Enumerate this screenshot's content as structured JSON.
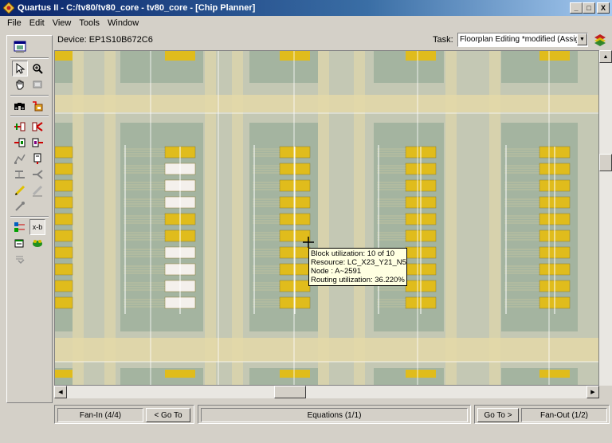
{
  "window": {
    "title": "Quartus II - C:/tv80/tv80_core - tv80_core - [Chip Planner]",
    "minimize": "_",
    "maximize": "□",
    "close": "X"
  },
  "menu": [
    "File",
    "Edit",
    "View",
    "Tools",
    "Window"
  ],
  "device": {
    "label": "Device: EP1S10B672C6"
  },
  "task": {
    "label": "Task:",
    "value": "Floorplan Editing *modified (Assignm"
  },
  "toolbar_tools": [
    "chip-planner-icon",
    "select-arrow-icon",
    "zoom-icon",
    "hand-icon",
    "rectangle-select-icon",
    "find-icon",
    "assignment-icon",
    "fan-in-icon",
    "fan-out-icon",
    "immediate-fan-in-icon",
    "immediate-fan-out-icon",
    "path-icon",
    "delay-icon",
    "generate-fan-in-icon",
    "generate-fan-out-icon",
    "pencil-icon",
    "eraser-pencil-icon",
    "eyedropper-icon",
    "connections-icon",
    "xor-label-icon",
    "layers-settings-icon",
    "critical-path-icon",
    "equation-icon"
  ],
  "x_label": "x-b",
  "tooltip": {
    "line1": "Block utilization: 10 of 10",
    "line2": "Resource: LC_X23_Y21_N5",
    "line3": "Node : A~2591",
    "line4": "Routing utilization: 36.220%"
  },
  "bottom": {
    "fan_in": "Fan-In (4/4)",
    "go_to_left": "< Go To",
    "equations": "Equations (1/1)",
    "go_to_right": "Go To >",
    "fan_out": "Fan-Out (1/2)"
  },
  "colors": {
    "canvas_bg": "#c4c8b4",
    "lab_bg": "#a4b4a0",
    "routing_tan": "#e4d8a8",
    "cell_yellow": "#e0bc1c",
    "cell_empty": "#f4f0ec"
  }
}
